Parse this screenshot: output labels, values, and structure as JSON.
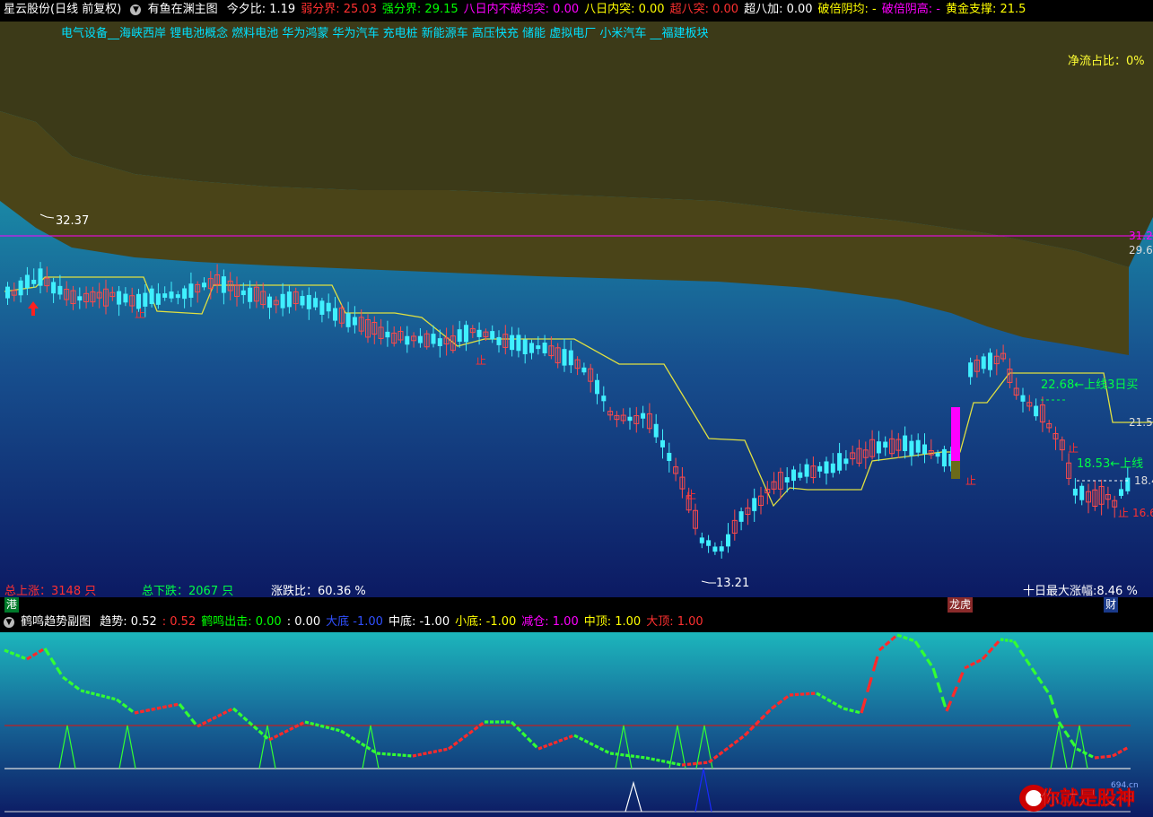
{
  "header": {
    "stock_title": "星云股份(日线 前复权)",
    "indicator_name": "有鱼在渊主图",
    "items": [
      {
        "label": "今夕比:",
        "value": "1.19",
        "color": "#ffffff"
      },
      {
        "label": "弱分界:",
        "value": "25.03",
        "color": "#ff3030"
      },
      {
        "label": "强分界:",
        "value": "29.15",
        "color": "#00ff00"
      },
      {
        "label": "八日内不破均突:",
        "value": "0.00",
        "color": "#ff00ff"
      },
      {
        "label": "八日内突:",
        "value": "0.00",
        "color": "#ffff00"
      },
      {
        "label": "超八突:",
        "value": "0.00",
        "color": "#ff3030"
      },
      {
        "label": "超八加:",
        "value": "0.00",
        "color": "#ffffff"
      },
      {
        "label": "破倍阴均:",
        "value": "-",
        "color": "#ffff00"
      },
      {
        "label": "破倍阴高:",
        "value": "-",
        "color": "#ff00ff"
      },
      {
        "label": "黄金支撑:",
        "value": "21.5",
        "color": "#ffff00"
      }
    ]
  },
  "main_chart": {
    "concepts": "电气设备__海峡西岸 锂电池概念 燃料电池 华为鸿蒙 华为汽车 充电桩 新能源车 高压快充 储能 虚拟电厂 小米汽车 __福建板块",
    "net_flow_ratio": "净流占比：0%",
    "high_label": "32.37",
    "low_label": "13.21",
    "price_labels": [
      "31.2",
      "29.6",
      "21.5",
      "18.4",
      "16.6"
    ],
    "signal_labels": [
      {
        "text": "22.68←上线3日买",
        "color": "#00ff44"
      },
      {
        "text": "18.53←上线",
        "color": "#00ff44"
      }
    ],
    "stop_label": "止",
    "stats": {
      "up_label": "总上涨：",
      "up_value": "3148 只",
      "down_label": "总下跌：",
      "down_value": "2067 只",
      "ratio_label": "涨跌比：",
      "ratio_value": "60.36 %",
      "max_gain": "十日最大涨幅:8.46 %"
    }
  },
  "events": [
    {
      "text": "港",
      "bg": "#007a2a"
    },
    {
      "text": "龙虎",
      "bg": "#8a2a2a"
    },
    {
      "text": "财",
      "bg": "#1a3a8a"
    }
  ],
  "sub_header": {
    "indicator_name": "鹤鸣趋势副图",
    "items": [
      {
        "label": "趋势:",
        "value": "0.52",
        "color": "#ffffff"
      },
      {
        "label": ":",
        "value": "0.52",
        "color": "#ff3030"
      },
      {
        "label": "鹤鸣出击:",
        "value": "0.00",
        "color": "#00ff00"
      },
      {
        "label": ":",
        "value": "0.00",
        "color": "#ffffff"
      },
      {
        "label": "大底",
        "value": "-1.00",
        "color": "#3050ff"
      },
      {
        "label": "中底:",
        "value": "-1.00",
        "color": "#ffffff"
      },
      {
        "label": "小底:",
        "value": "-1.00",
        "color": "#ffff00"
      },
      {
        "label": "减仓:",
        "value": "1.00",
        "color": "#ff00ff"
      },
      {
        "label": "中顶:",
        "value": "1.00",
        "color": "#ffff00"
      },
      {
        "label": "大顶:",
        "value": "1.00",
        "color": "#ff3030"
      }
    ]
  },
  "watermark": {
    "text": "你就是股神",
    "url": "694.cn"
  }
}
